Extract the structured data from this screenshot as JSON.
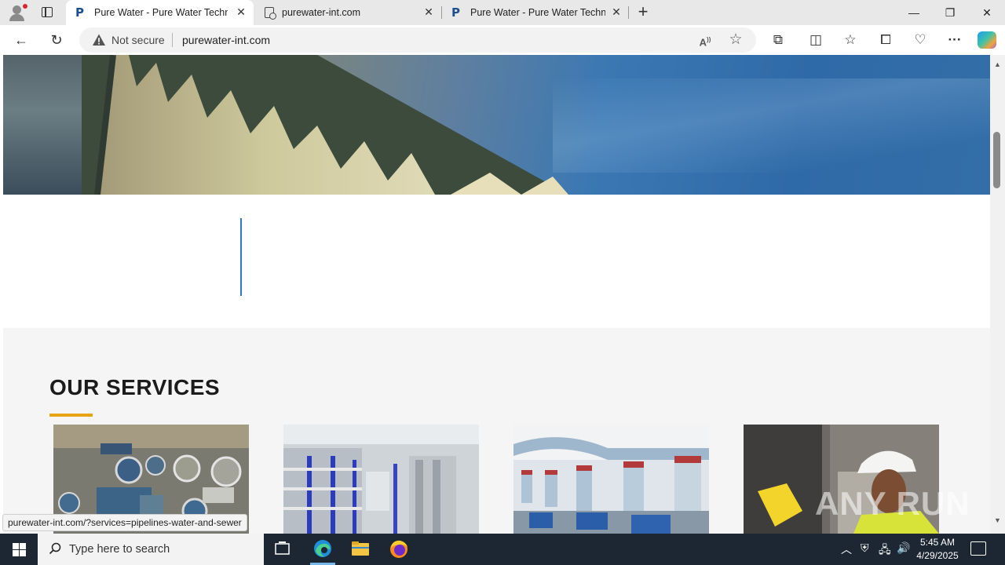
{
  "browser": {
    "tabs": [
      {
        "title": "Pure Water - Pure Water Technol",
        "active": true,
        "favicon": "pure-water-p-logo"
      },
      {
        "title": "purewater-int.com",
        "active": false,
        "favicon": "document-icon"
      },
      {
        "title": "Pure Water - Pure Water Technol",
        "active": false,
        "favicon": "pure-water-p-logo"
      }
    ],
    "security_label": "Not secure",
    "url": "purewater-int.com"
  },
  "page": {
    "services_heading": "OUR SERVICES",
    "accent_color": "#e8a317",
    "line_color": "#2a79c9",
    "service_cards": [
      {
        "image": "wastewater-treatment-plant-aerial"
      },
      {
        "image": "reverse-osmosis-membrane-racks"
      },
      {
        "image": "pumping-station-pipes"
      },
      {
        "image": "technician-hard-hat"
      }
    ]
  },
  "status_bar": {
    "hover_url": "purewater-int.com/?services=pipelines-water-and-sewer"
  },
  "watermark": "ANY RUN",
  "taskbar": {
    "search_placeholder": "Type here to search",
    "time": "5:45 AM",
    "date": "4/29/2025"
  }
}
